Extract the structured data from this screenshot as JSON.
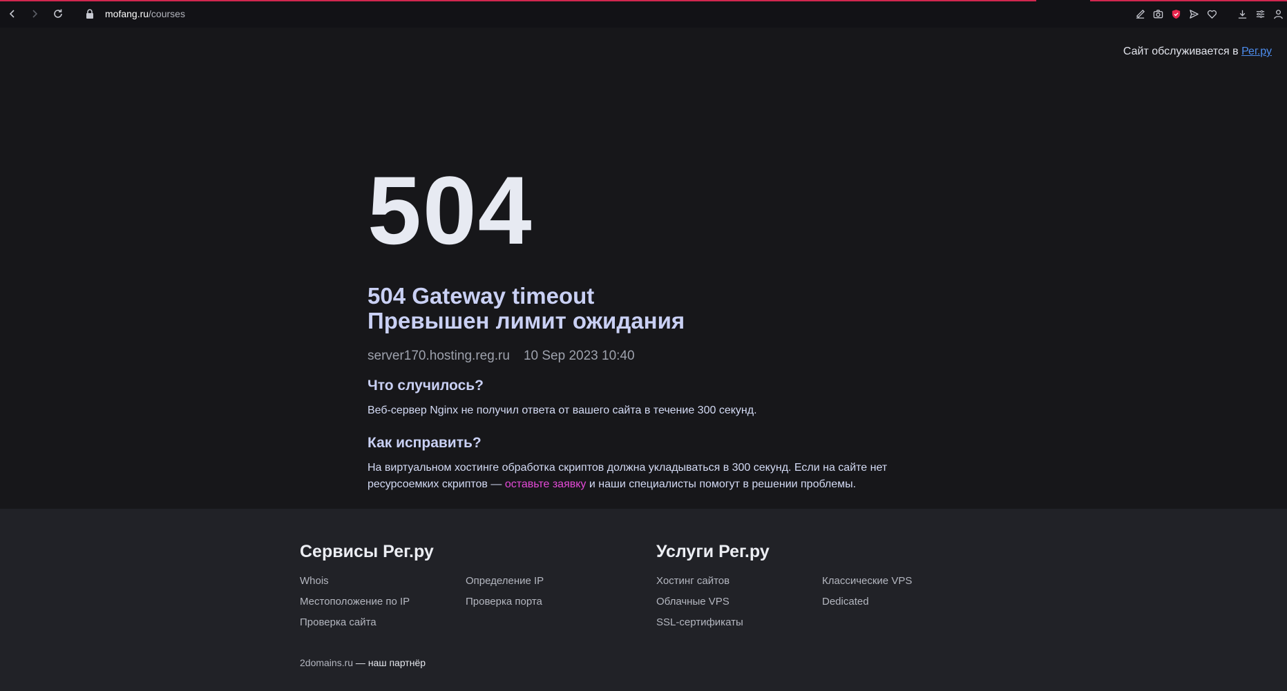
{
  "browser": {
    "url_host": "mofang.ru",
    "url_path": "/courses"
  },
  "header": {
    "served_prefix": "Сайт обслуживается в ",
    "served_link": "Рег.ру"
  },
  "error": {
    "code": "504",
    "title_en": "504 Gateway timeout",
    "title_ru": "Превышен лимит ожидания",
    "server": "server170.hosting.reg.ru",
    "datetime": "10 Sep 2023 10:40",
    "what_heading": "Что случилось?",
    "what_text": "Веб-сервер Nginx не получил ответа от вашего сайта в течение 300 секунд.",
    "fix_heading": "Как исправить?",
    "fix_text_before": "На виртуальном хостинге обработка скриптов должна укладываться в 300 секунд. Если на сайте нет ресурсоемких скриптов — ",
    "fix_link": "оставьте заявку",
    "fix_text_after": " и наши специалисты помогут в решении проблемы."
  },
  "footer": {
    "services": {
      "heading": "Сервисы Рег.ру",
      "links": [
        "Whois",
        "Местоположение по IP",
        "Проверка сайта",
        "Определение IP",
        "Проверка порта"
      ]
    },
    "offers": {
      "heading": "Услуги Рег.ру",
      "links": [
        "Хостинг сайтов",
        "Облачные VPS",
        "SSL-сертификаты",
        "Классические VPS",
        "Dedicated"
      ]
    },
    "partner_link": "2domains.ru",
    "partner_suffix": " — наш партнёр"
  }
}
